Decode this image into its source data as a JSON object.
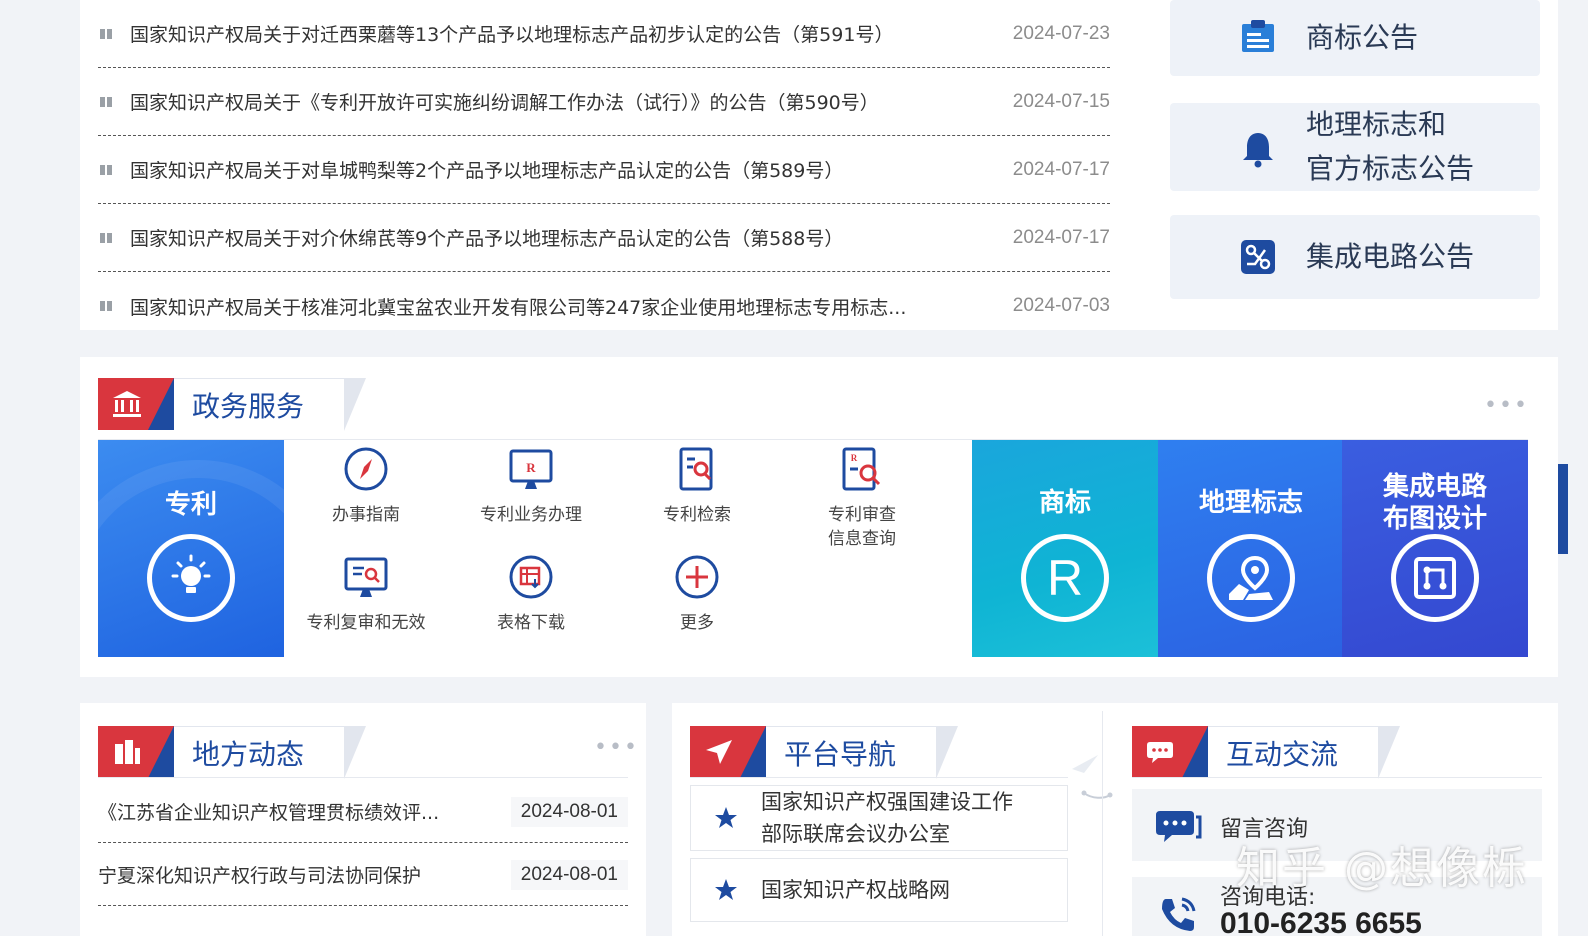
{
  "news": {
    "items": [
      {
        "title": "国家知识产权局关于对迁西栗蘑等13个产品予以地理标志产品初步认定的公告（第591号）",
        "date": "2024-07-23"
      },
      {
        "title": "国家知识产权局关于《专利开放许可实施纠纷调解工作办法（试行）》的公告（第590号）",
        "date": "2024-07-15"
      },
      {
        "title": "国家知识产权局关于对阜城鸭梨等2个产品予以地理标志产品认定的公告（第589号）",
        "date": "2024-07-17"
      },
      {
        "title": "国家知识产权局关于对介休绵芪等9个产品予以地理标志产品认定的公告（第588号）",
        "date": "2024-07-17"
      },
      {
        "title": "国家知识产权局关于核准河北冀宝盆农业开发有限公司等247家企业使用地理标志专用标志...",
        "date": "2024-07-03"
      }
    ]
  },
  "notices": {
    "trademark": "商标公告",
    "geo_line1": "地理标志和",
    "geo_line2": "官方标志公告",
    "ic": "集成电路公告"
  },
  "services": {
    "section_title": "政务服务",
    "more": "•••",
    "patent_tile": "专利",
    "items": [
      {
        "label": "办事指南"
      },
      {
        "label": "专利业务办理"
      },
      {
        "label": "专利检索"
      },
      {
        "label": "专利审查\n信息查询"
      },
      {
        "label": "专利复审和无效"
      },
      {
        "label": "表格下载"
      },
      {
        "label": "更多"
      }
    ],
    "tiles": {
      "trademark": "商标",
      "geo": "地理标志",
      "ic_line1": "集成电路",
      "ic_line2": "布图设计",
      "trademark_symbol": "R"
    }
  },
  "local": {
    "section_title": "地方动态",
    "more": "•••",
    "items": [
      {
        "title": "《江苏省企业知识产权管理贯标绩效评...",
        "date": "2024-08-01"
      },
      {
        "title": "宁夏深化知识产权行政与司法协同保护",
        "date": "2024-08-01"
      }
    ]
  },
  "platform": {
    "section_title": "平台导航",
    "links": [
      {
        "line1": "国家知识产权强国建设工作",
        "line2": "部际联席会议办公室"
      },
      {
        "line1": "国家知识产权战略网",
        "line2": ""
      }
    ]
  },
  "interact": {
    "section_title": "互动交流",
    "consult": "留言咨询",
    "phone_label": "咨询电话:",
    "phone_number": "010-6235 6655"
  },
  "watermark": "知乎 @想像栎",
  "colors": {
    "brand_blue": "#1e4ba0",
    "brand_red": "#d9363e",
    "patent_tile": "#2a74ea",
    "trademark_tile": "#14a9d6",
    "geo_tile": "#2f6ee6",
    "ic_tile": "#3a52d8"
  }
}
